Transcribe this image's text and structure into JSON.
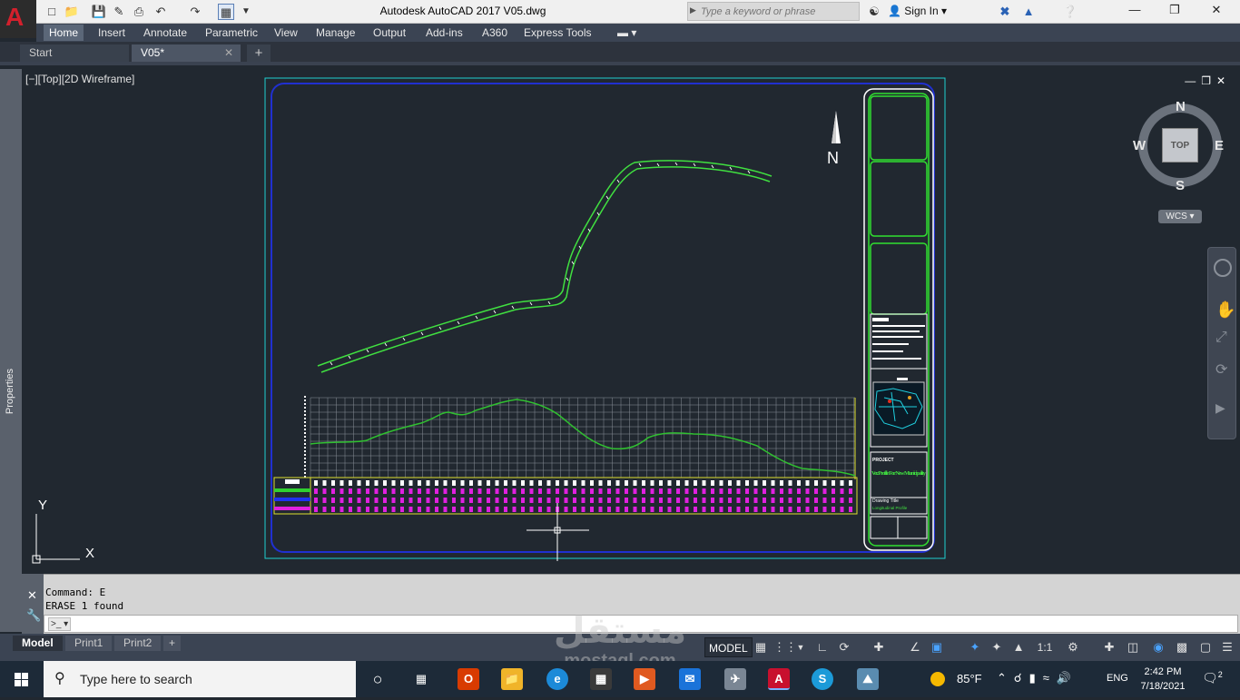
{
  "window": {
    "title": "Autodesk AutoCAD 2017    V05.dwg",
    "app_letter": "A",
    "search_placeholder": "Type a keyword or phrase",
    "sign_in": "Sign In"
  },
  "ribbon": {
    "tabs": [
      "Home",
      "Insert",
      "Annotate",
      "Parametric",
      "View",
      "Manage",
      "Output",
      "Add-ins",
      "A360",
      "Express Tools"
    ]
  },
  "doc_tabs": {
    "start": "Start",
    "active": "V05*"
  },
  "viewport": {
    "view_label": "[−][Top][2D Wireframe]",
    "properties_label": "Properties",
    "viewcube": {
      "n": "N",
      "s": "S",
      "e": "E",
      "w": "W",
      "face": "TOP",
      "wcs": "WCS"
    },
    "ucs": {
      "x": "X",
      "y": "Y"
    },
    "north_label": "N"
  },
  "title_block": {
    "project_label": "PROJECT",
    "project_name": "Ver. Profile For New Municipality",
    "drawing_title_label": "Drawing Title",
    "drawing_title": "Longitudinal Profile"
  },
  "command": {
    "history": [
      "Command: E",
      "ERASE 1 found"
    ],
    "input_value": ""
  },
  "layout_tabs": [
    "Model",
    "Print1",
    "Print2"
  ],
  "status_bar": {
    "model": "MODEL",
    "scale": "1:1"
  },
  "taskbar": {
    "search_text": "Type here to search",
    "temperature": "85°F",
    "language": "ENG",
    "time": "2:42 PM",
    "date": "7/18/2021",
    "notifications": "2"
  },
  "watermark": {
    "arabic": "مستقل",
    "latin": "mostaql.com"
  }
}
